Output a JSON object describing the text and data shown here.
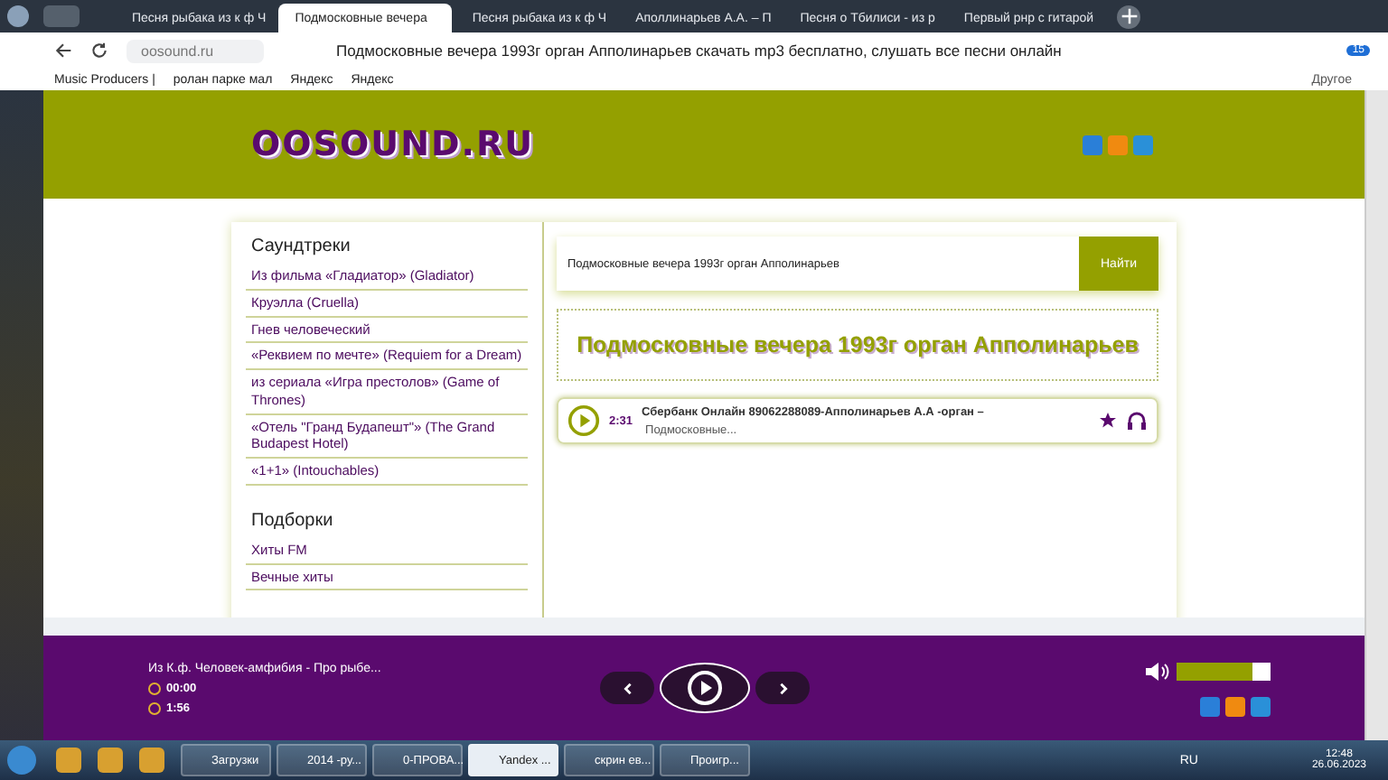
{
  "browser": {
    "tabs": [
      {
        "title": "Песня рыбака из к ф Ч",
        "selected": false
      },
      {
        "title": "Подмосковные вечера",
        "selected": true
      },
      {
        "title": "Песня рыбака из к ф Ч",
        "selected": false
      },
      {
        "title": "Аполлинарьев А.А. – П",
        "selected": false
      },
      {
        "title": "Песня о Тбилиси - из р",
        "selected": false
      },
      {
        "title": "Первый рнр с гитарой",
        "selected": false
      }
    ],
    "url": "oosound.ru",
    "page_title": "Подмосковные вечера 1993г орган Апполинарьев скачать mp3 бесплатно, слушать все песни онлайн",
    "download_count": "15",
    "bookmarks": [
      "Music Producers |",
      "ролан парке мал",
      "Яндекс",
      "Яндекс"
    ],
    "more": "Другое"
  },
  "site": {
    "logo": "OOSOUND.RU",
    "sections": [
      {
        "heading": "Саундтреки",
        "items": [
          "Из фильма «Гладиатор» (Gladiator)",
          "Круэлла (Cruella)",
          "Гнев человеческий",
          "«Реквием по мечте» (Requiem for a Dream)",
          "из сериала «Игра престолов» (Game of Thrones)",
          "«Отель \"Гранд Будапешт\"» (The Grand Budapest Hotel)",
          "«1+1» (Intouchables)"
        ]
      },
      {
        "heading": "Подборки",
        "items": [
          "Хиты FM",
          "Вечные хиты"
        ]
      }
    ],
    "search": {
      "value": "Подмосковные вечера 1993г орган Апполинарьев",
      "button": "Найти"
    },
    "heading": "Подмосковные вечера 1993г орган Апполинарьев",
    "tracks": [
      {
        "duration": "2:31",
        "title": "Сбербанк Онлайн 89062288089-Апполинарьев А.А -орган –",
        "subtitle": "Подмосковные..."
      }
    ]
  },
  "player": {
    "now_playing": "Из К.ф. Человек-амфибия - Про рыбе...",
    "elapsed": "00:00",
    "total": "1:56",
    "volume": {
      "level": 0.8
    }
  },
  "taskbar": {
    "items": [
      {
        "label": "Загрузки",
        "selected": false
      },
      {
        "label": "2014 -ру...",
        "selected": false
      },
      {
        "label": "0-ПРОВА...",
        "selected": false
      },
      {
        "label": "Yandex ...",
        "selected": true
      },
      {
        "label": "скрин ев...",
        "selected": false
      },
      {
        "label": "Проигр...",
        "selected": false
      }
    ],
    "lang": "RU",
    "time": "12:48",
    "date": "26.06.2023"
  }
}
